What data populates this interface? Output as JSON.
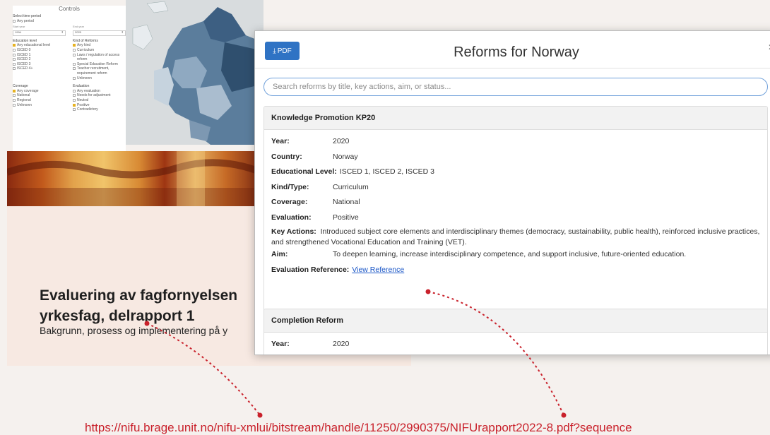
{
  "controls": {
    "title": "Controls",
    "time_period_label": "Select time period",
    "any_period": "Any period",
    "start_label": "Start year",
    "start_value": "1994",
    "end_label": "End year",
    "end_value": "2025",
    "education_level_title": "Education level",
    "education_levels": [
      "Any educational level",
      "ISCED 0",
      "ISCED 1",
      "ISCED 2",
      "ISCED 3",
      "ISCED 4+"
    ],
    "kind_title": "Kind of Reforms",
    "kinds": [
      "Any kind",
      "Curriculum",
      "Laws / regulation of access reform",
      "Special Education Reform",
      "Teacher recruitment, requirement reform",
      "Unknown"
    ],
    "coverage_title": "Coverage",
    "coverages": [
      "Any coverage",
      "National",
      "Regional",
      "Unknown"
    ],
    "evaluation_title": "Evaluation",
    "evaluations": [
      "Any evaluation",
      "Needs for adjustment",
      "Neutral",
      "Positive",
      "Contradictory"
    ]
  },
  "modal": {
    "pdf_label": "PDF",
    "title": "Reforms for Norway",
    "search_placeholder": "Search reforms by title, key actions, aim, or status...",
    "reforms": [
      {
        "title": "Knowledge Promotion KP20",
        "fields": [
          {
            "label": "Year:",
            "value": "2020"
          },
          {
            "label": "Country:",
            "value": "Norway"
          },
          {
            "label": "Educational Level:",
            "value": "ISCED 1, ISCED 2, ISCED 3"
          },
          {
            "label": "Kind/Type:",
            "value": "Curriculum"
          },
          {
            "label": "Coverage:",
            "value": "National"
          },
          {
            "label": "Evaluation:",
            "value": "Positive"
          },
          {
            "label": "Key Actions:",
            "value": "Introduced subject core elements and interdisciplinary themes (democracy, sustainability, public health), reinforced inclusive practices, and strengthened Vocational Education and Training (VET)."
          },
          {
            "label": "Aim:",
            "value": "To deepen learning, increase interdisciplinary competence, and support inclusive, future-oriented education."
          },
          {
            "label": "Evaluation Reference:",
            "value": "View Reference"
          }
        ]
      },
      {
        "title": "Completion Reform",
        "fields": [
          {
            "label": "Year:",
            "value": "2020"
          }
        ]
      }
    ]
  },
  "report": {
    "title_line1": "Evaluering av fagfornyelsen",
    "title_line2": "yrkesfag, delrapport 1",
    "subtitle": "Bakgrunn, prosess og implementering på y"
  },
  "url": "https://nifu.brage.unit.no/nifu-xmlui/bitstream/handle/11250/2990375/NIFUrapport2022-8.pdf?sequence",
  "colors": {
    "accent_blue": "#2f73c4",
    "link_blue": "#1a56c7",
    "connector_red": "#c9212b",
    "checkbox_yellow": "#e6b222",
    "report_bg": "#f7e9e2"
  }
}
